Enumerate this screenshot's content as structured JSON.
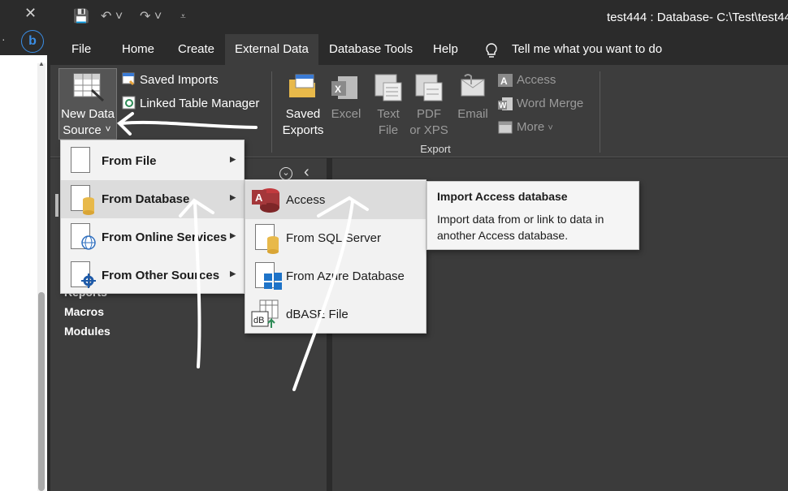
{
  "left_panel": {
    "close_glyph": "✕",
    "bing_glyph": "b",
    "dot_glyph": "·",
    "scroll_up_glyph": "▲"
  },
  "title_bar": {
    "title": "test444 : Database- C:\\Test\\test44",
    "save_glyph": "💾",
    "undo_glyph": "↶ ˅",
    "redo_glyph": "↷ ˅",
    "customize_glyph": "⩡"
  },
  "menu_tabs": [
    {
      "label": "File"
    },
    {
      "label": "Home"
    },
    {
      "label": "Create"
    },
    {
      "label": "External Data",
      "active": true
    },
    {
      "label": "Database Tools"
    },
    {
      "label": "Help"
    }
  ],
  "tell_me": {
    "icon": "lightbulb-icon",
    "label": "Tell me what you want to do"
  },
  "ribbon": {
    "import": {
      "new_data_source_line1": "New Data",
      "new_data_source_line2": "Source",
      "new_data_source_caret": "˅",
      "saved_imports": "Saved Imports",
      "linked_table_manager": "Linked Table Manager"
    },
    "export": {
      "group_label": "Export",
      "saved_exports_line1": "Saved",
      "saved_exports_line2": "Exports",
      "excel": "Excel",
      "text_file_line1": "Text",
      "text_file_line2": "File",
      "pdf_line1": "PDF",
      "pdf_line2": "or XPS",
      "email": "Email",
      "access": "Access",
      "word_merge": "Word Merge",
      "more": "More",
      "more_caret": "˅"
    }
  },
  "nav_pane": {
    "dropdown_glyph": "⌄",
    "collapse_glyph": "‹",
    "partial_item": "Reports",
    "items": [
      "Macros",
      "Modules"
    ]
  },
  "new_data_source_menu": {
    "items": [
      {
        "label": "From File",
        "icon": "file-icon"
      },
      {
        "label": "From Database",
        "icon": "database-icon",
        "highlighted": true
      },
      {
        "label": "From Online Services",
        "icon": "globe-icon"
      },
      {
        "label": "From Other Sources",
        "icon": "gear-icon"
      }
    ],
    "arrow_glyph": "▶"
  },
  "database_submenu": {
    "items": [
      {
        "label": "Access",
        "icon": "access-icon",
        "highlighted": true
      },
      {
        "label": "From SQL Server",
        "icon": "sql-server-icon"
      },
      {
        "label": "From Azure Database",
        "icon": "azure-icon"
      },
      {
        "label": "dBASE File",
        "icon": "dbase-icon"
      }
    ]
  },
  "tooltip": {
    "title": "Import Access database",
    "body": "Import data from or link to data in another Access database."
  },
  "colors": {
    "accent": "#a4373a",
    "ribbon": "#3d3d3d",
    "titlebar": "#2b2b2b",
    "menu": "#f2f2f2"
  }
}
